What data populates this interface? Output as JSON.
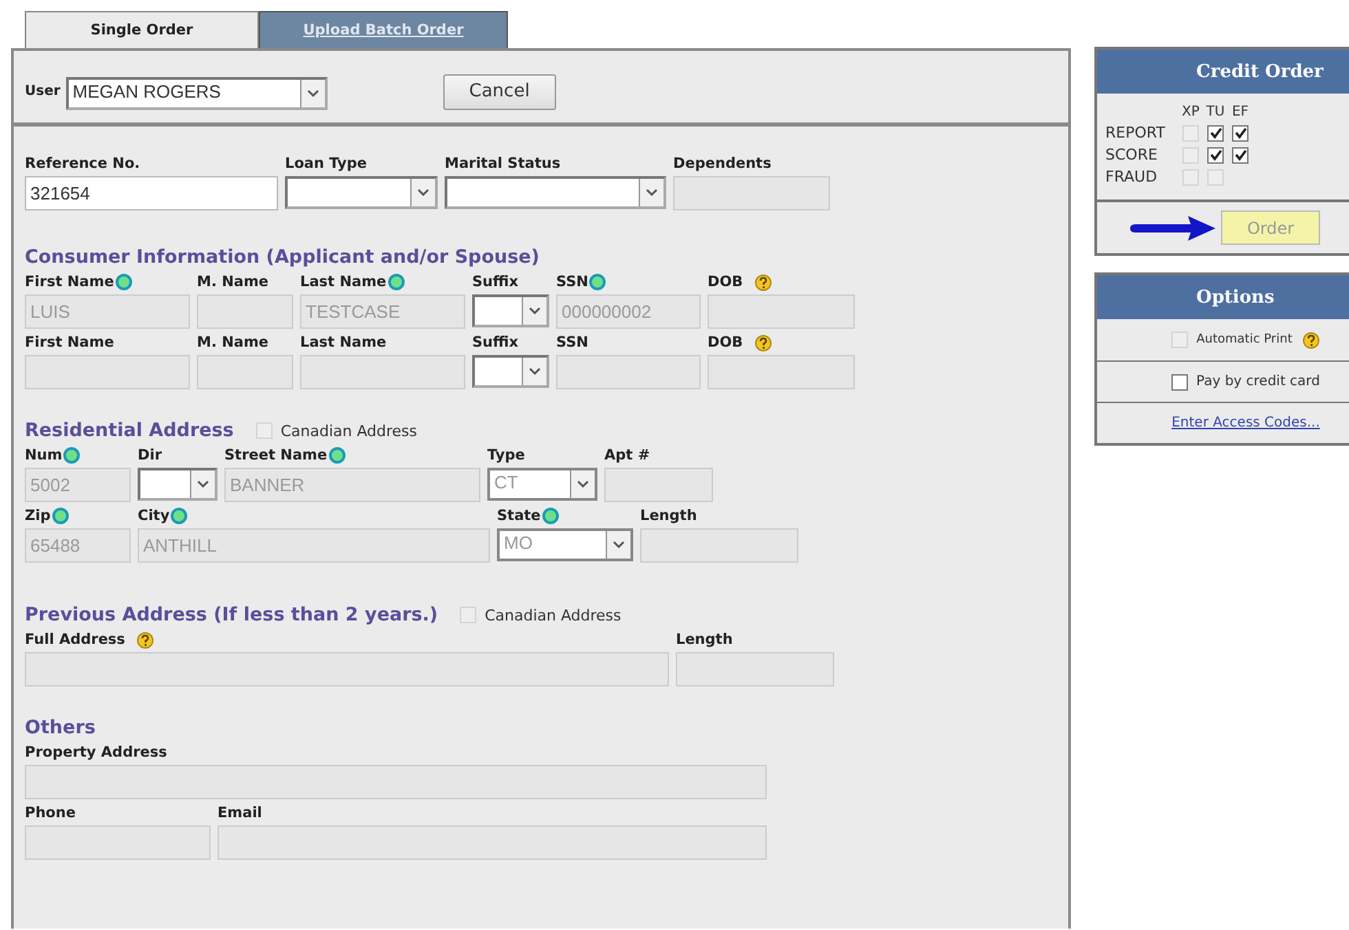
{
  "tabs": [
    {
      "label": "Single Order",
      "selected": true
    },
    {
      "label": "Upload Batch Order",
      "selected": false
    }
  ],
  "user_bar": {
    "label": "User",
    "value": "MEGAN ROGERS",
    "cancel": "Cancel"
  },
  "sections": [
    {
      "lines": [
        {
          "fields": [
            {
              "label": "Reference No.",
              "kind": "text",
              "value": "321654",
              "disabled": false,
              "required": false,
              "help": false
            },
            {
              "label": "Loan Type",
              "kind": "select",
              "disabled": false,
              "required": false,
              "help": false
            },
            {
              "label": "Marital Status",
              "kind": "select",
              "disabled": false,
              "required": false,
              "help": false
            },
            {
              "label": "Dependents",
              "kind": "text",
              "disabled": true,
              "required": false,
              "help": false
            }
          ]
        }
      ]
    },
    {
      "title": "Consumer Information (Applicant and/or Spouse)",
      "lines": [
        {
          "fields": [
            {
              "label": "First Name",
              "kind": "text",
              "value": "LUIS",
              "disabled": true,
              "required": true,
              "help": false
            },
            {
              "label": "M. Name",
              "kind": "text",
              "disabled": true,
              "required": false,
              "help": false
            },
            {
              "label": "Last Name",
              "kind": "text",
              "value": "TESTCASE",
              "disabled": true,
              "required": true,
              "help": false
            },
            {
              "label": "Suffix",
              "kind": "select",
              "disabled": false,
              "required": false,
              "help": false
            },
            {
              "label": "SSN",
              "kind": "text",
              "value": "000000002",
              "disabled": true,
              "required": true,
              "help": false
            },
            {
              "label": "DOB",
              "kind": "text",
              "disabled": true,
              "required": false,
              "help": true
            }
          ]
        },
        {
          "fields": [
            {
              "label": "First Name",
              "kind": "text",
              "disabled": true,
              "required": false,
              "help": false
            },
            {
              "label": "M. Name",
              "kind": "text",
              "disabled": true,
              "required": false,
              "help": false
            },
            {
              "label": "Last Name",
              "kind": "text",
              "disabled": true,
              "required": false,
              "help": false
            },
            {
              "label": "Suffix",
              "kind": "select",
              "disabled": false,
              "required": false,
              "help": false
            },
            {
              "label": "SSN",
              "kind": "text",
              "disabled": true,
              "required": false,
              "help": false
            },
            {
              "label": "DOB",
              "kind": "text",
              "disabled": true,
              "required": false,
              "help": true
            }
          ]
        }
      ]
    },
    {
      "title": "Residential Address",
      "canadian": {
        "label": "Canadian Address",
        "checked": false
      },
      "lines": [
        {
          "fields": [
            {
              "label": "Num",
              "kind": "text",
              "value": "5002",
              "disabled": true,
              "required": true,
              "help": false
            },
            {
              "label": "Dir",
              "kind": "select",
              "disabled": false,
              "required": false,
              "help": false
            },
            {
              "label": "Street Name",
              "kind": "text",
              "value": "BANNER",
              "disabled": true,
              "required": true,
              "help": false
            },
            {
              "label": "Type",
              "kind": "select",
              "value": "CT",
              "disabled": true,
              "required": false,
              "help": false
            },
            {
              "label": "Apt #",
              "kind": "text",
              "disabled": true,
              "required": false,
              "help": false
            }
          ]
        },
        {
          "fields": [
            {
              "label": "Zip",
              "kind": "text",
              "value": "65488",
              "disabled": true,
              "required": true,
              "help": false
            },
            {
              "label": "City",
              "kind": "text",
              "value": "ANTHILL",
              "disabled": true,
              "required": true,
              "help": false
            },
            {
              "label": "State",
              "kind": "select",
              "value": "MO",
              "disabled": true,
              "required": true,
              "help": false
            },
            {
              "label": "Length",
              "kind": "text",
              "disabled": true,
              "required": false,
              "help": false
            }
          ]
        }
      ]
    },
    {
      "title": "Previous Address (If less than 2 years.)",
      "canadian": {
        "label": "Canadian Address",
        "checked": false
      },
      "lines": [
        {
          "fields": [
            {
              "label": "Full Address",
              "kind": "text",
              "disabled": true,
              "required": false,
              "help": true
            },
            {
              "label": "Length",
              "kind": "text",
              "disabled": true,
              "required": false,
              "help": false
            }
          ]
        }
      ]
    },
    {
      "title": "Others",
      "lines": [
        {
          "fields": [
            {
              "label": "Property Address",
              "kind": "text",
              "disabled": true,
              "required": false,
              "help": false
            }
          ]
        },
        {
          "fields": [
            {
              "label": "Phone",
              "kind": "text",
              "disabled": true,
              "required": false,
              "help": false
            },
            {
              "label": "Email",
              "kind": "text",
              "disabled": true,
              "required": false,
              "help": false
            }
          ]
        }
      ]
    }
  ],
  "credit_order": {
    "title": "Credit Order",
    "columns": [
      "XP",
      "TU",
      "EF"
    ],
    "rows": [
      {
        "label": "REPORT",
        "cells": [
          {
            "checked": false,
            "disabled": true
          },
          {
            "checked": true,
            "disabled": false
          },
          {
            "checked": true,
            "disabled": false
          }
        ]
      },
      {
        "label": "SCORE",
        "cells": [
          {
            "checked": false,
            "disabled": true
          },
          {
            "checked": true,
            "disabled": false
          },
          {
            "checked": true,
            "disabled": false
          }
        ]
      },
      {
        "label": "FRAUD",
        "cells": [
          {
            "checked": false,
            "disabled": true
          },
          {
            "checked": false,
            "disabled": true
          }
        ]
      }
    ],
    "order_button": "Order"
  },
  "options": {
    "title": "Options",
    "items": [
      {
        "kind": "checkbox",
        "label": "Automatic Print",
        "checked": false,
        "disabled": true,
        "help": true
      },
      {
        "kind": "checkbox",
        "label": "Pay by credit card",
        "checked": false,
        "disabled": false,
        "help": false
      },
      {
        "kind": "link",
        "label": "Enter Access Codes..."
      }
    ]
  }
}
